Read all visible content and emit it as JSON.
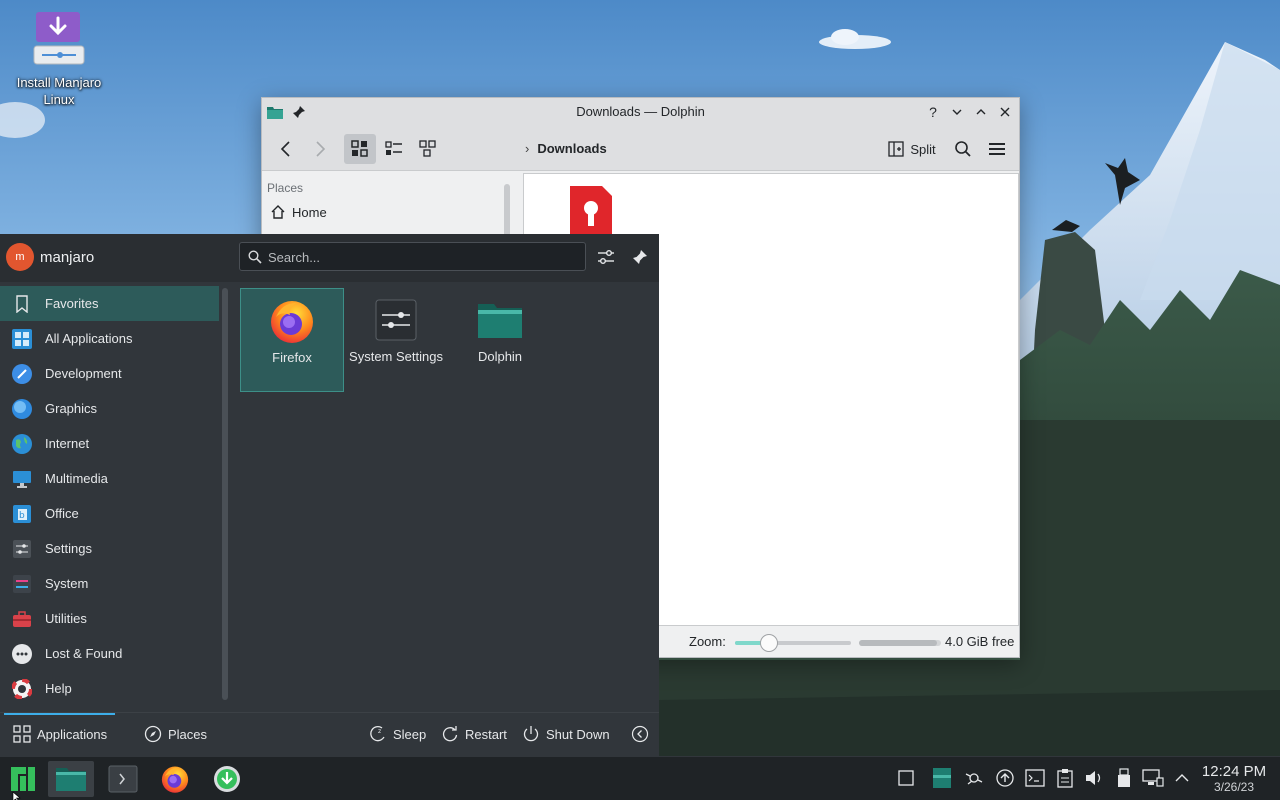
{
  "desktop": {
    "install_icon_label": "Install Manjaro Linux"
  },
  "dolphin": {
    "title": "Downloads — Dolphin",
    "breadcrumb": "Downloads",
    "split_label": "Split",
    "places_header": "Places",
    "places_home": "Home",
    "zoom_label": "Zoom:",
    "zoom_level": 0.25,
    "free_space": "4.0 GiB free",
    "free_fraction": 0.95,
    "help_glyph": "?"
  },
  "launcher": {
    "username": "manjaro",
    "avatar_initial": "m",
    "search_placeholder": "Search...",
    "categories": [
      {
        "label": "Favorites",
        "icon": "bookmark-icon",
        "selected": true
      },
      {
        "label": "All Applications",
        "icon": "grid-icon"
      },
      {
        "label": "Development",
        "icon": "development-icon"
      },
      {
        "label": "Graphics",
        "icon": "graphics-icon"
      },
      {
        "label": "Internet",
        "icon": "globe-icon"
      },
      {
        "label": "Multimedia",
        "icon": "multimedia-icon"
      },
      {
        "label": "Office",
        "icon": "office-icon"
      },
      {
        "label": "Settings",
        "icon": "settings-icon"
      },
      {
        "label": "System",
        "icon": "system-icon"
      },
      {
        "label": "Utilities",
        "icon": "toolbox-icon"
      },
      {
        "label": "Lost & Found",
        "icon": "ellipsis-icon"
      },
      {
        "label": "Help",
        "icon": "lifebuoy-icon"
      }
    ],
    "apps": [
      {
        "label": "Firefox",
        "icon": "firefox-icon",
        "selected": true
      },
      {
        "label": "System Settings",
        "icon": "system-settings-icon"
      },
      {
        "label": "Dolphin",
        "icon": "folder-icon"
      }
    ],
    "footer": {
      "applications": "Applications",
      "places": "Places",
      "sleep": "Sleep",
      "restart": "Restart",
      "shutdown": "Shut Down"
    }
  },
  "taskbar": {
    "time": "12:24 PM",
    "date": "3/26/23"
  },
  "colors": {
    "accent": "#3daee9",
    "selection": "#2d5b5a",
    "manjaro_green": "#35bf5c"
  }
}
